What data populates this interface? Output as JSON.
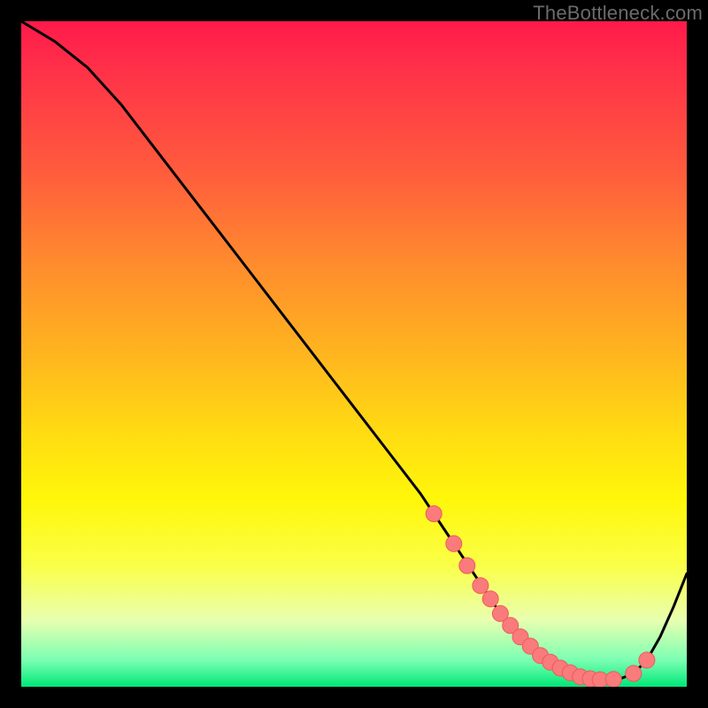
{
  "attribution": "TheBottleneck.com",
  "colors": {
    "marker_fill": "#f97b7b",
    "marker_stroke": "#ef5a5a",
    "curve_stroke": "#000000"
  },
  "chart_data": {
    "type": "line",
    "title": "",
    "xlabel": "",
    "ylabel": "",
    "xlim": [
      0,
      100
    ],
    "ylim": [
      0,
      100
    ],
    "grid": false,
    "series": [
      {
        "name": "bottleneck-curve",
        "x": [
          0,
          5,
          10,
          15,
          20,
          25,
          30,
          35,
          40,
          45,
          50,
          55,
          60,
          62,
          65,
          68,
          70,
          72,
          74,
          76,
          78,
          80,
          82,
          84,
          86,
          88,
          90,
          92,
          94,
          96,
          98,
          100
        ],
        "y": [
          100,
          97,
          93,
          87.5,
          81,
          74.5,
          68,
          61.5,
          55,
          48.5,
          42,
          35.5,
          29,
          26,
          21.5,
          17,
          14,
          11,
          8.5,
          6.3,
          4.5,
          3,
          2,
          1.4,
          1.1,
          1.0,
          1.2,
          2,
          4,
          7.5,
          12,
          17
        ]
      }
    ],
    "markers": {
      "name": "valley-markers",
      "x": [
        62,
        65,
        67,
        69,
        70.5,
        72,
        73.5,
        75,
        76.5,
        78,
        79.5,
        81,
        82.5,
        84,
        85.5,
        87,
        89,
        92,
        94
      ],
      "y": [
        26,
        21.5,
        18.2,
        15.2,
        13.2,
        11,
        9.2,
        7.5,
        6.1,
        4.7,
        3.7,
        2.8,
        2.1,
        1.5,
        1.2,
        1.05,
        1.1,
        2,
        4
      ],
      "r": 9
    }
  }
}
